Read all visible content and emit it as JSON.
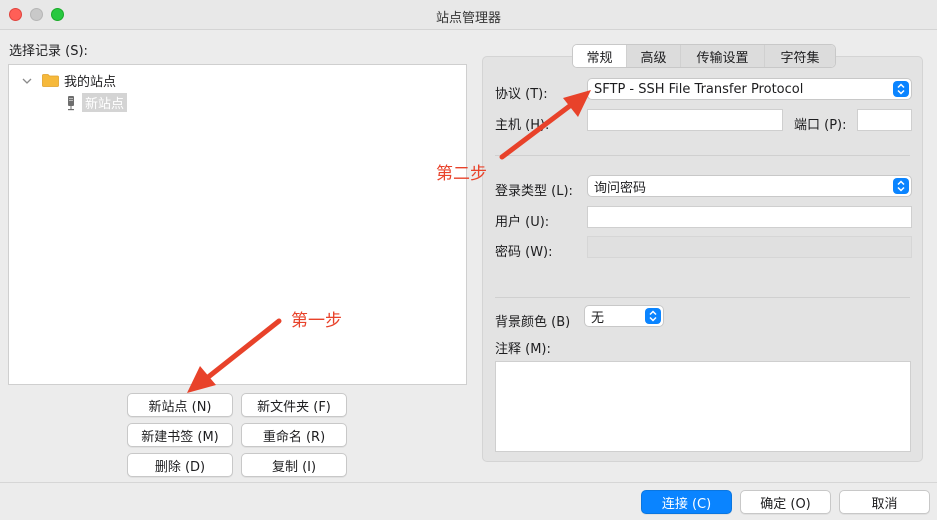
{
  "window": {
    "title": "站点管理器"
  },
  "left": {
    "label": "选择记录 (S):",
    "tree": {
      "folder": "我的站点",
      "site": "新站点"
    },
    "buttons": {
      "new_site": "新站点 (N)",
      "new_folder": "新文件夹 (F)",
      "new_bookmark": "新建书签 (M)",
      "rename": "重命名 (R)",
      "delete": "删除 (D)",
      "copy": "复制 (I)"
    }
  },
  "tabs": [
    "常规",
    "高级",
    "传输设置",
    "字符集"
  ],
  "form": {
    "protocol_label": "协议 (T):",
    "protocol_value": "SFTP - SSH File Transfer Protocol",
    "host_label": "主机 (H):",
    "host_value": "",
    "port_label": "端口 (P):",
    "port_value": "",
    "logon_label": "登录类型 (L):",
    "logon_value": "询问密码",
    "user_label": "用户 (U):",
    "user_value": "",
    "password_label": "密码 (W):",
    "bgcolor_label": "背景颜色 (B)",
    "bgcolor_value": "无",
    "comments_label": "注释 (M):"
  },
  "annotations": {
    "step1": "第一步",
    "step2": "第二步"
  },
  "footer": {
    "connect": "连接 (C)",
    "ok": "确定 (O)",
    "cancel": "取消"
  },
  "colors": {
    "accent": "#0a84ff",
    "annotation": "#e8422a"
  }
}
